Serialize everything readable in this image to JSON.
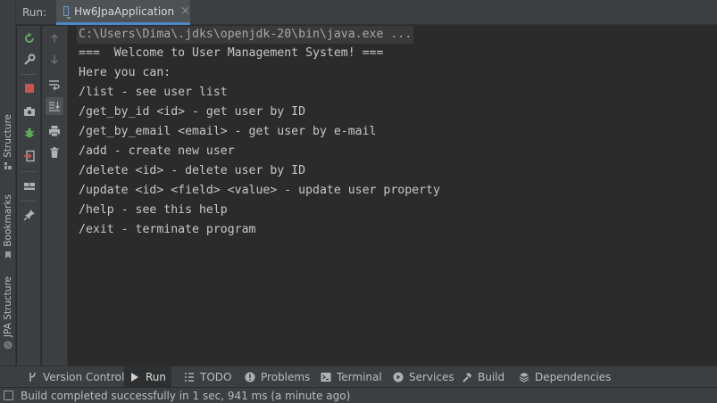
{
  "header": {
    "run_label": "Run:",
    "tab_title": "Hw6JpaApplication",
    "tab_close": "×"
  },
  "side_tabs": {
    "structure": "Structure",
    "bookmarks": "Bookmarks",
    "jpa_structure": "JPA Structure"
  },
  "console": {
    "command": "C:\\Users\\Dima\\.jdks\\openjdk-20\\bin\\java.exe ...",
    "lines": [
      "===  Welcome to User Management System! ===",
      "Here you can:",
      "/list - see user list",
      "/get_by_id <id> - get user by ID",
      "/get_by_email <email> - get user by e-mail",
      "/add - create new user",
      "/delete <id> - delete user by ID",
      "/update <id> <field> <value> - update user property",
      "/help - see this help",
      "/exit - terminate program"
    ]
  },
  "bottom_tabs": {
    "version_control": "Version Control",
    "run": "Run",
    "todo": "TODO",
    "problems": "Problems",
    "terminal": "Terminal",
    "services": "Services",
    "build": "Build",
    "dependencies": "Dependencies"
  },
  "status": {
    "message": "Build completed successfully in 1 sec, 941 ms (a minute ago)"
  },
  "colors": {
    "accent": "#4a88c7",
    "stop_red": "#c75450",
    "run_green": "#5faa5a"
  }
}
